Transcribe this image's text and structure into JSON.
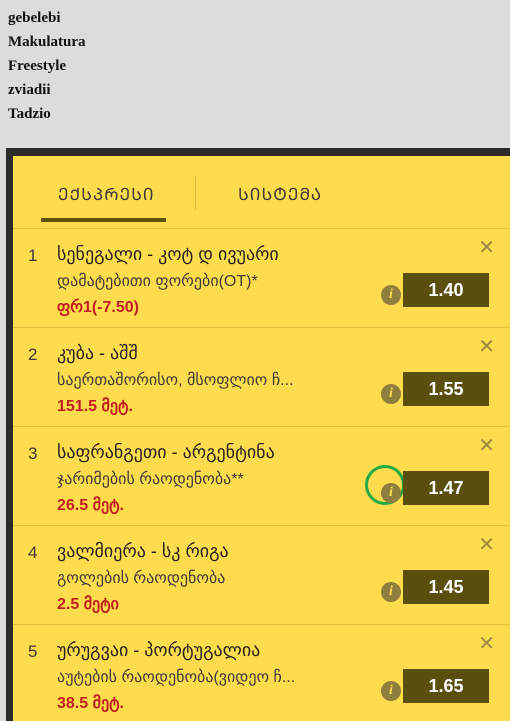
{
  "usernames": [
    "gebelebi",
    "Makulatura",
    "Freestyle",
    "zviadii",
    "Tadzio"
  ],
  "tabs": {
    "express": "ᲔᲥᲡᲞᲠᲔᲡᲘ",
    "system": "ᲡᲘᲡᲢᲔᲛᲐ"
  },
  "bets": [
    {
      "num": "1",
      "title": "სენეგალი - კოტ დ ივუარი",
      "market": "დამატებითი ფორები(OT)*",
      "selection": "ფრ1(-7.50)",
      "odds": "1.40",
      "info": "i",
      "close": "✕"
    },
    {
      "num": "2",
      "title": "კუბა - აშშ",
      "market": "საერთაშორისო, მსოფლიო ჩ...",
      "selection": "151.5 მეტ.",
      "odds": "1.55",
      "info": "i",
      "close": "✕"
    },
    {
      "num": "3",
      "title": "საფრანგეთი - არგენტინა",
      "market": "ჯარიმების რაოდენობა**",
      "selection": "26.5 მეტ.",
      "odds": "1.47",
      "info": "i",
      "close": "✕"
    },
    {
      "num": "4",
      "title": "ვალმიერა - სკ რიგა",
      "market": "გოლების რაოდენობა",
      "selection": "2.5 მეტი",
      "odds": "1.45",
      "info": "i",
      "close": "✕"
    },
    {
      "num": "5",
      "title": "ურუგვაი - პორტუგალია",
      "market": "აუტების რაოდენობა(ვიდეო ჩ...",
      "selection": "38.5 მეტ.",
      "odds": "1.65",
      "info": "i",
      "close": "✕"
    }
  ],
  "colors": {
    "panel_bg": "#fedc4e",
    "odds_bg": "#5b4f10",
    "selection": "#c11f1f",
    "highlight_ring": "#22aa44"
  }
}
